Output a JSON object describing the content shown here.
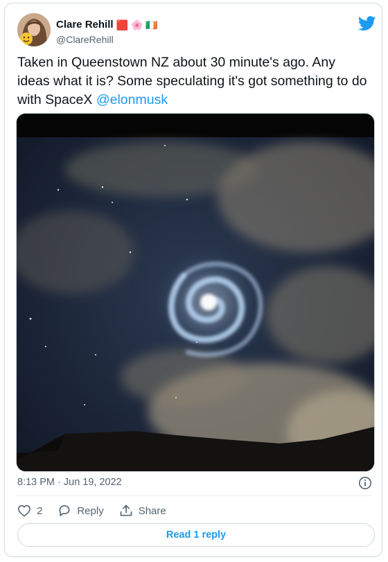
{
  "author": {
    "display_name": "Clare Rehill",
    "handle": "@ClareRehill",
    "emojis": [
      "🟥",
      "🌸",
      "🇮🇪"
    ]
  },
  "tweet": {
    "text": "Taken in Queenstown NZ about 30 minute's ago. Any ideas what it is? Some speculating it's got something to do with SpaceX ",
    "mention": "@elonmusk",
    "timestamp": "8:13 PM · Jun 19, 2022"
  },
  "actions": {
    "like_count": "2",
    "reply_label": "Reply",
    "share_label": "Share"
  },
  "read_replies_label": "Read 1 reply",
  "colors": {
    "accent": "#1d9bf0",
    "secondary_text": "#536471",
    "border": "#cfd9de"
  },
  "icons": [
    "twitter-bird-icon",
    "info-icon",
    "heart-icon",
    "reply-icon",
    "share-icon"
  ]
}
